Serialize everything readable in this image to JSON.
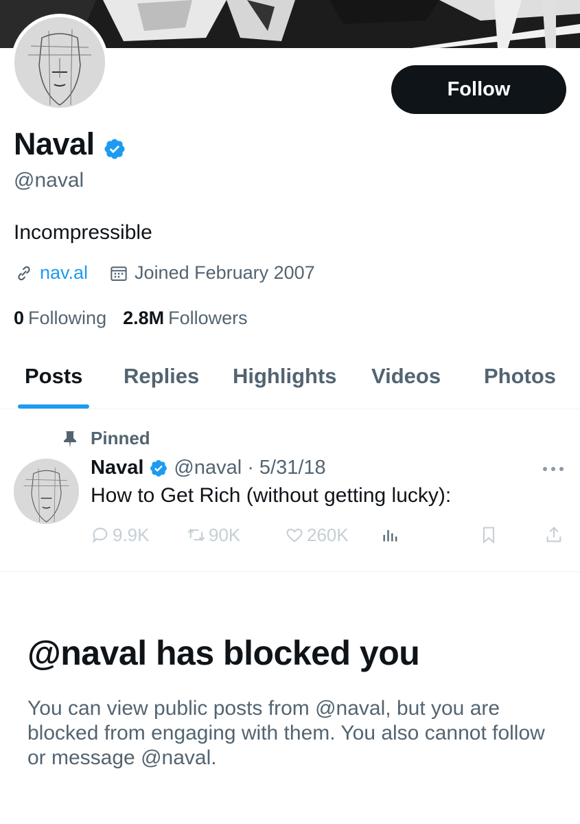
{
  "profile": {
    "display_name": "Naval",
    "handle": "@naval",
    "bio": "Incompressible",
    "website": "nav.al",
    "joined": "Joined February 2007",
    "following_count": "0",
    "following_label": "Following",
    "followers_count": "2.8M",
    "followers_label": "Followers",
    "follow_button": "Follow"
  },
  "tabs": [
    {
      "label": "Posts",
      "active": true
    },
    {
      "label": "Replies"
    },
    {
      "label": "Highlights"
    },
    {
      "label": "Videos"
    },
    {
      "label": "Photos"
    }
  ],
  "pinned_post": {
    "pinned_label": "Pinned",
    "author": "Naval",
    "handle_date": "@naval · 5/31/18",
    "text": "How to Get Rich (without getting lucky):",
    "replies": "9.9K",
    "reposts": "90K",
    "likes": "260K"
  },
  "blocked": {
    "title": "@naval has blocked you",
    "message": "You can view public posts from @naval, but you are blocked from engaging with them. You also cannot follow or message @naval."
  },
  "colors": {
    "accent": "#1d9bf0",
    "text_primary": "#0f1419",
    "text_secondary": "#536471",
    "button_bg": "#0f1419"
  },
  "icons": {
    "verified": "verified-badge-icon",
    "link": "link-icon",
    "calendar": "calendar-icon",
    "pin": "pin-icon",
    "reply": "reply-icon",
    "repost": "repost-icon",
    "like": "heart-icon",
    "views": "analytics-icon",
    "bookmark": "bookmark-icon",
    "share": "share-icon",
    "more": "more-icon"
  }
}
